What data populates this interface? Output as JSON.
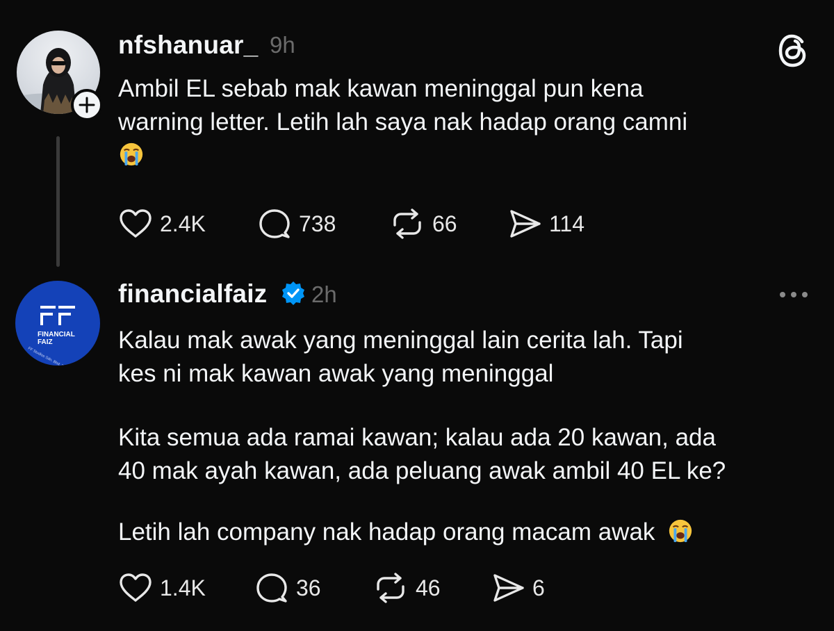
{
  "post1": {
    "username": "nfshanuar_",
    "time": "9h",
    "text_line1": "Ambil EL sebab mak kawan meninggal pun kena",
    "text_line2": "warning letter. Letih lah saya nak hadap orang camni",
    "emoji": "loudly-crying-face",
    "likes": "2.4K",
    "replies": "738",
    "reposts": "66",
    "shares": "114"
  },
  "post2": {
    "username": "financialfaiz",
    "verified": true,
    "time": "2h",
    "avatar_logo": "FF",
    "avatar_line1": "FINANCIAL",
    "avatar_line2": "FAIZ",
    "avatar_caption": "FF Studios Sdn. Bhd. 202001021781",
    "para1_line1": "Kalau mak awak yang meninggal lain cerita lah. Tapi",
    "para1_line2": "kes ni mak kawan awak yang meninggal",
    "para2_line1": "Kita semua ada ramai kawan; kalau ada 20 kawan, ada",
    "para2_line2": "40 mak ayah kawan, ada peluang awak ambil 40 EL ke?",
    "para3": "Letih lah company nak hadap orang macam awak",
    "emoji": "loudly-crying-face",
    "likes": "1.4K",
    "replies": "36",
    "reposts": "46",
    "shares": "6"
  },
  "colors": {
    "background": "#0a0a0a",
    "text": "#f3f5f7",
    "muted": "#6b6b6b",
    "verified": "#0095f6",
    "avatar_blue": "#1442b8"
  },
  "icons": [
    "threads-logo-icon",
    "plus-icon",
    "heart-icon",
    "comment-icon",
    "repost-icon",
    "share-icon",
    "verified-badge-icon",
    "more-options-icon"
  ]
}
